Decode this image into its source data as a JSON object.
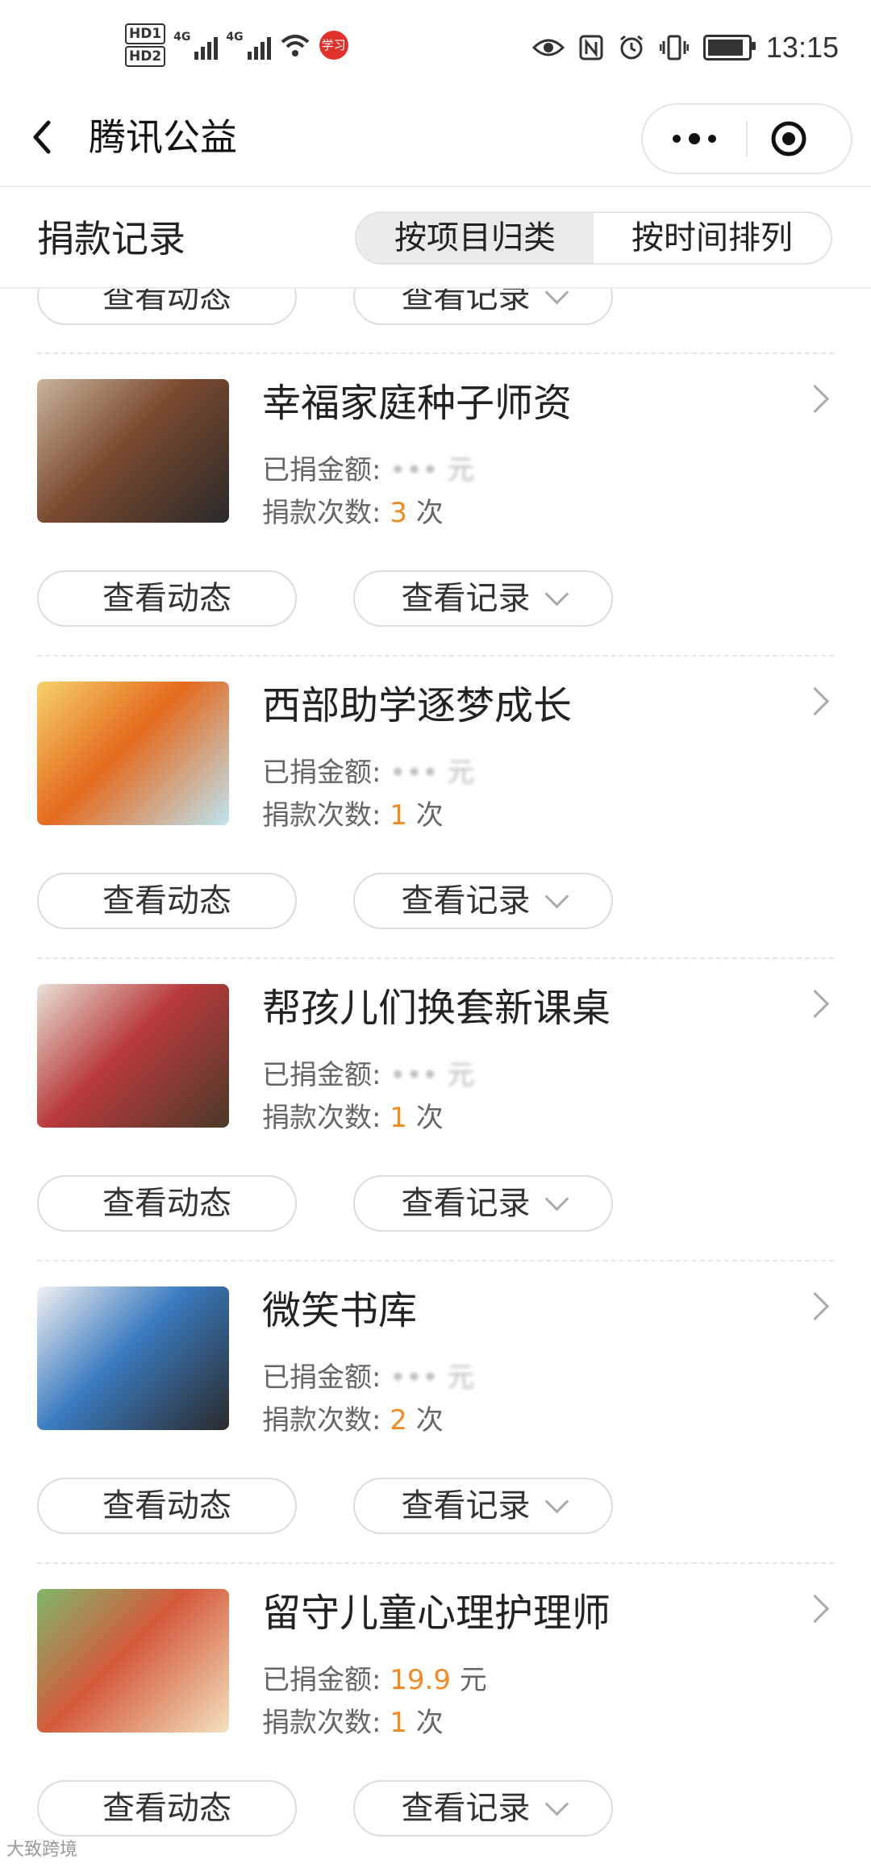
{
  "status_bar": {
    "hd1": "HD1",
    "hd2": "HD2",
    "net1": "4G",
    "net2": "4G",
    "notif": "学习",
    "time": "13:15"
  },
  "nav": {
    "title": "腾讯公益"
  },
  "filter": {
    "title": "捐款记录",
    "tabs": [
      {
        "label": "按项目归类",
        "active": true
      },
      {
        "label": "按时间排列",
        "active": false
      }
    ]
  },
  "labels": {
    "view_updates": "查看动态",
    "view_records": "查看记录",
    "donated_amount": "已捐金额:",
    "donation_count": "捐款次数:",
    "times_unit": "次",
    "yuan": "元"
  },
  "projects": [
    {
      "title": "幸福家庭种子师资",
      "amount": "",
      "count": "3",
      "thumb_colors": [
        "#7a4a2e",
        "#c9b59b",
        "#2a2a2a"
      ]
    },
    {
      "title": "西部助学逐梦成长",
      "amount": "",
      "count": "1",
      "thumb_colors": [
        "#e46a1e",
        "#f6d36a",
        "#bfe4f0"
      ]
    },
    {
      "title": "帮孩儿们换套新课桌",
      "amount": "",
      "count": "1",
      "thumb_colors": [
        "#b93a3a",
        "#e9e2d8",
        "#4a3a2a"
      ]
    },
    {
      "title": "微笑书库",
      "amount": "",
      "count": "2",
      "thumb_colors": [
        "#3a7bbf",
        "#f2f2f2",
        "#2b2b2b"
      ]
    },
    {
      "title": "留守儿童心理护理师",
      "amount": "19.9",
      "count": "1",
      "thumb_colors": [
        "#d45a3a",
        "#7fb86a",
        "#f3e2c0"
      ]
    }
  ],
  "watermark": "大致跨境",
  "colors": {
    "accent": "#f08a24",
    "notif_dot": "#e2302b"
  }
}
